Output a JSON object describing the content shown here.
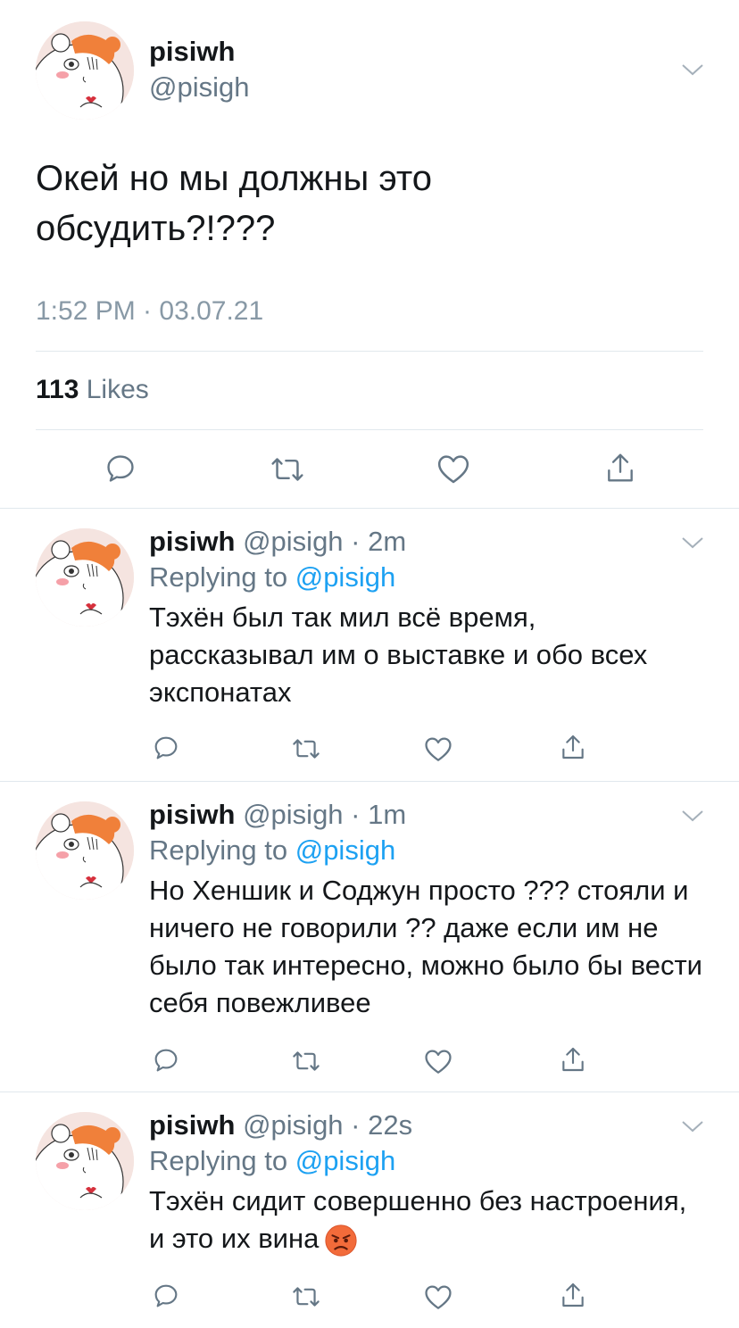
{
  "main_tweet": {
    "name": "pisiwh",
    "handle": "@pisigh",
    "text_line1": "Окей но мы должны это",
    "text_line2": "обсудить?!???",
    "timestamp": "1:52 PM · 03.07.21",
    "likes_count": "113",
    "likes_label": "Likes"
  },
  "replies": [
    {
      "name": "pisiwh",
      "handle": "@pisigh",
      "time": "2m",
      "replying_label": "Replying to",
      "replying_handle": "@pisigh",
      "text": "Тэхён был так мил всё время, рассказывал им о выставке и обо всех экспонатах"
    },
    {
      "name": "pisiwh",
      "handle": "@pisigh",
      "time": "1m",
      "replying_label": "Replying to",
      "replying_handle": "@pisigh",
      "text": "Но Хеншик и Соджун просто ??? стояли и ничего не говорили ?? даже если им не было так интересно, можно было бы вести себя повежливее"
    },
    {
      "name": "pisiwh",
      "handle": "@pisigh",
      "time": "22s",
      "replying_label": "Replying to",
      "replying_handle": "@pisigh",
      "text": "Тэхён сидит совершенно без настроения, и это их вина",
      "emoji": "angry-face-emoji"
    }
  ],
  "icons": {
    "avatar": "hamster-avatar",
    "menu": "chevron-down-icon",
    "reply": "reply-bubble-icon",
    "retweet": "retweet-icon",
    "like": "heart-icon",
    "share": "share-icon"
  },
  "colors": {
    "text": "#14171a",
    "secondary": "#657786",
    "link": "#1da1f2",
    "divider": "#e1e8ed"
  }
}
